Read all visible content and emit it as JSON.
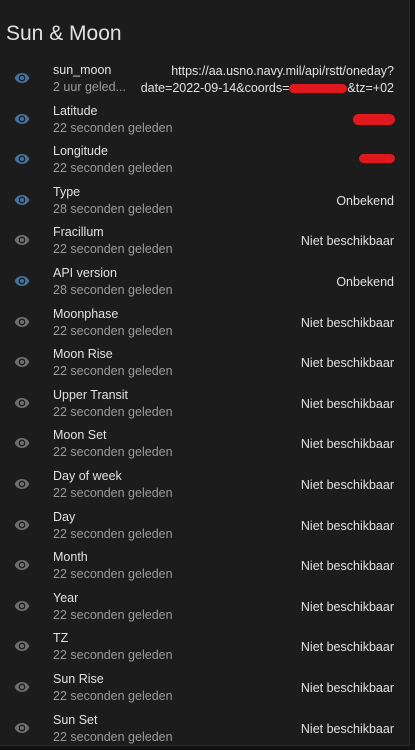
{
  "card": {
    "title": "Sun & Moon"
  },
  "colors": {
    "eye_active": "#44739e",
    "eye_inactive": "#6f6f6f",
    "redaction": "#e0191f"
  },
  "rows": [
    {
      "name": "sun_moon",
      "sub": "2 uur geled...",
      "state_line1": "https://aa.usno.navy.mil/api/rstt/oneday?",
      "state_line2_prefix": "date=2022-09-14&coords=",
      "state_line2_suffix": "&tz=+02",
      "icon": "eye-icon-active"
    },
    {
      "name": "Latitude",
      "sub": "22 seconden geleden",
      "state": "",
      "icon": "eye-icon-active"
    },
    {
      "name": "Longitude",
      "sub": "22 seconden geleden",
      "state": "",
      "icon": "eye-icon-active"
    },
    {
      "name": "Type",
      "sub": "28 seconden geleden",
      "state": "Onbekend",
      "icon": "eye-icon-active"
    },
    {
      "name": "Fracillum",
      "sub": "22 seconden geleden",
      "state": "Niet beschikbaar",
      "icon": "eye-icon-inactive"
    },
    {
      "name": "API version",
      "sub": "28 seconden geleden",
      "state": "Onbekend",
      "icon": "eye-icon-active"
    },
    {
      "name": "Moonphase",
      "sub": "22 seconden geleden",
      "state": "Niet beschikbaar",
      "icon": "eye-icon-inactive"
    },
    {
      "name": "Moon Rise",
      "sub": "22 seconden geleden",
      "state": "Niet beschikbaar",
      "icon": "eye-icon-inactive"
    },
    {
      "name": "Upper Transit",
      "sub": "22 seconden geleden",
      "state": "Niet beschikbaar",
      "icon": "eye-icon-inactive"
    },
    {
      "name": "Moon Set",
      "sub": "22 seconden geleden",
      "state": "Niet beschikbaar",
      "icon": "eye-icon-inactive"
    },
    {
      "name": "Day of week",
      "sub": "22 seconden geleden",
      "state": "Niet beschikbaar",
      "icon": "eye-icon-inactive"
    },
    {
      "name": "Day",
      "sub": "22 seconden geleden",
      "state": "Niet beschikbaar",
      "icon": "eye-icon-inactive"
    },
    {
      "name": "Month",
      "sub": "22 seconden geleden",
      "state": "Niet beschikbaar",
      "icon": "eye-icon-inactive"
    },
    {
      "name": "Year",
      "sub": "22 seconden geleden",
      "state": "Niet beschikbaar",
      "icon": "eye-icon-inactive"
    },
    {
      "name": "TZ",
      "sub": "22 seconden geleden",
      "state": "Niet beschikbaar",
      "icon": "eye-icon-inactive"
    },
    {
      "name": "Sun Rise",
      "sub": "22 seconden geleden",
      "state": "Niet beschikbaar",
      "icon": "eye-icon-inactive"
    },
    {
      "name": "Sun Set",
      "sub": "22 seconden geleden",
      "state": "Niet beschikbaar",
      "icon": "eye-icon-inactive"
    }
  ]
}
